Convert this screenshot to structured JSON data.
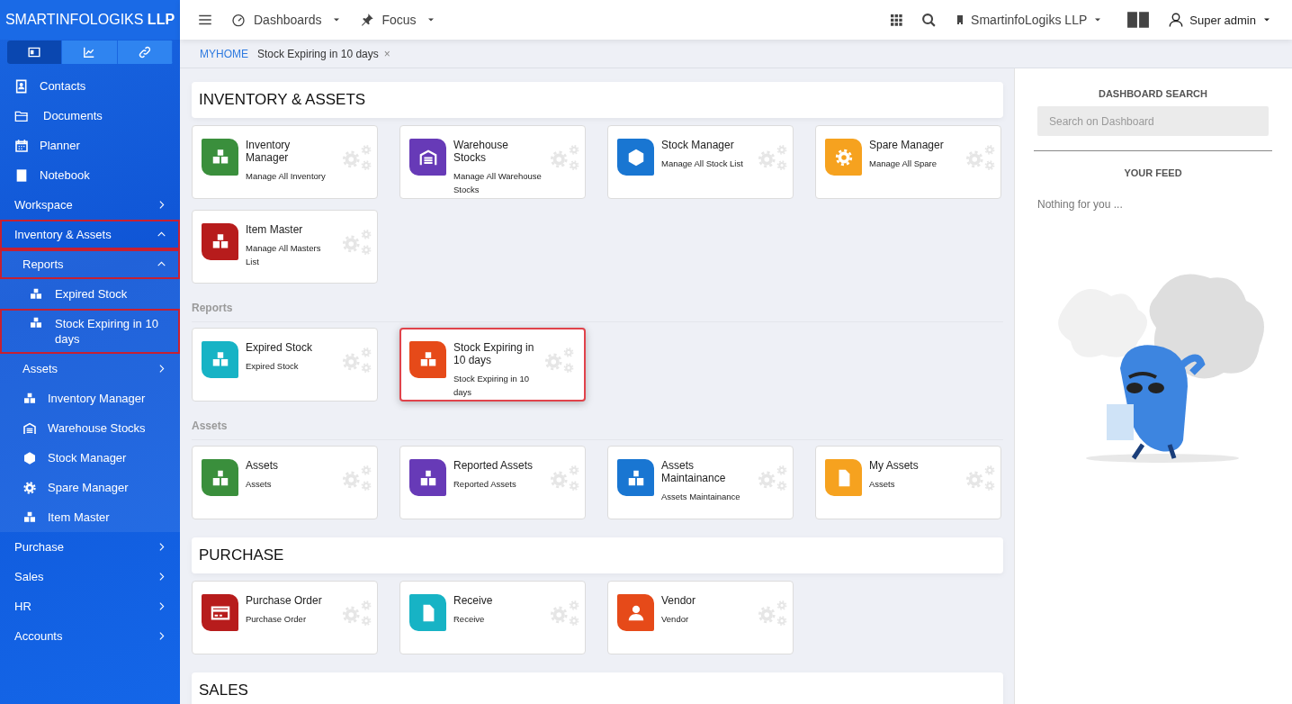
{
  "brand": "SMARTINFOLOGIKS **LLP**",
  "sidebar": {
    "tabs": [
      {
        "selected": true
      },
      {
        "selected": false
      },
      {
        "selected": false
      }
    ],
    "items": [
      {
        "kind": "link",
        "label": "Contacts",
        "highlighted": false
      },
      {
        "kind": "link",
        "label": "Documents",
        "highlighted": false
      },
      {
        "kind": "link",
        "label": "Planner",
        "highlighted": false
      },
      {
        "kind": "link",
        "label": "Notebook",
        "highlighted": false
      },
      {
        "kind": "group",
        "label": "Workspace",
        "expanded": false,
        "highlighted": false
      },
      {
        "kind": "group",
        "label": "Inventory & Assets",
        "expanded": true,
        "highlighted": true,
        "children": [
          {
            "kind": "group",
            "label": "Reports",
            "expanded": true,
            "highlighted": true,
            "children": [
              {
                "kind": "link",
                "label": "Expired Stock",
                "highlighted": false
              },
              {
                "kind": "link",
                "label": "Stock Expiring in 10 days",
                "highlighted": true
              }
            ]
          },
          {
            "kind": "group",
            "label": "Assets",
            "expanded": false,
            "highlighted": false
          },
          {
            "kind": "link",
            "label": "Inventory Manager",
            "highlighted": false
          },
          {
            "kind": "link",
            "label": "Warehouse Stocks",
            "highlighted": false
          },
          {
            "kind": "link",
            "label": "Stock Manager",
            "highlighted": false
          },
          {
            "kind": "link",
            "label": "Spare Manager",
            "highlighted": false
          },
          {
            "kind": "link",
            "label": "Item Master",
            "highlighted": false
          }
        ]
      },
      {
        "kind": "group",
        "label": "Purchase",
        "expanded": false,
        "highlighted": false
      },
      {
        "kind": "group",
        "label": "Sales",
        "expanded": false,
        "highlighted": false
      },
      {
        "kind": "group",
        "label": "HR",
        "expanded": false,
        "highlighted": false
      },
      {
        "kind": "group",
        "label": "Accounts",
        "expanded": false,
        "highlighted": false
      }
    ]
  },
  "topbar": {
    "menus": [
      "Dashboards",
      "Focus"
    ],
    "company": "SmartinfoLogiks LLP",
    "user": "Super admin"
  },
  "breadcrumb": {
    "home": "MYHOME",
    "current": "Stock Expiring in 10 days",
    "close": "×"
  },
  "sections": [
    {
      "title": "INVENTORY & ASSETS",
      "groups": [
        {
          "cards": [
            {
              "title": "Inventory Manager",
              "subtitle": "Manage All Inventory",
              "color": "#3a8f3c",
              "highlighted": false
            },
            {
              "title": "Warehouse Stocks",
              "subtitle": "Manage All Warehouse Stocks",
              "color": "#673ab7",
              "highlighted": false
            },
            {
              "title": "Stock Manager",
              "subtitle": "Manage All Stock List",
              "color": "#1976d2",
              "highlighted": false
            },
            {
              "title": "Spare Manager",
              "subtitle": "Manage All Spare",
              "color": "#f6a21f",
              "highlighted": false
            },
            {
              "title": "Item Master",
              "subtitle": "Manage All Masters List",
              "color": "#b71c1c",
              "highlighted": false
            }
          ]
        },
        {
          "label": "Reports",
          "cards": [
            {
              "title": "Expired Stock",
              "subtitle": "Expired Stock",
              "color": "#17b3c5",
              "highlighted": false
            },
            {
              "title": "Stock Expiring in 10 days",
              "subtitle": "Stock Expiring in 10 days",
              "color": "#e64a19",
              "highlighted": true
            }
          ]
        },
        {
          "label": "Assets",
          "cards": [
            {
              "title": "Assets",
              "subtitle": "Assets",
              "color": "#3a8f3c",
              "highlighted": false
            },
            {
              "title": "Reported Assets",
              "subtitle": "Reported Assets",
              "color": "#673ab7",
              "highlighted": false
            },
            {
              "title": "Assets Maintainance",
              "subtitle": "Assets Maintainance",
              "color": "#1976d2",
              "highlighted": false
            },
            {
              "title": "My Assets",
              "subtitle": "Assets",
              "color": "#f6a21f",
              "highlighted": false
            }
          ]
        }
      ]
    },
    {
      "title": "PURCHASE",
      "groups": [
        {
          "cards": [
            {
              "title": "Purchase Order",
              "subtitle": "Purchase Order",
              "color": "#b71c1c",
              "highlighted": false
            },
            {
              "title": "Receive",
              "subtitle": "Receive",
              "color": "#17b3c5",
              "highlighted": false
            },
            {
              "title": "Vendor",
              "subtitle": "Vendor",
              "color": "#e64a19",
              "highlighted": false
            }
          ]
        }
      ]
    },
    {
      "title": "SALES"
    }
  ],
  "feed_panel": {
    "search_title": "DASHBOARD SEARCH",
    "search": {
      "placeholder": "Search on Dashboard"
    },
    "feed_title": "YOUR FEED",
    "empty": "Nothing for you ..."
  }
}
